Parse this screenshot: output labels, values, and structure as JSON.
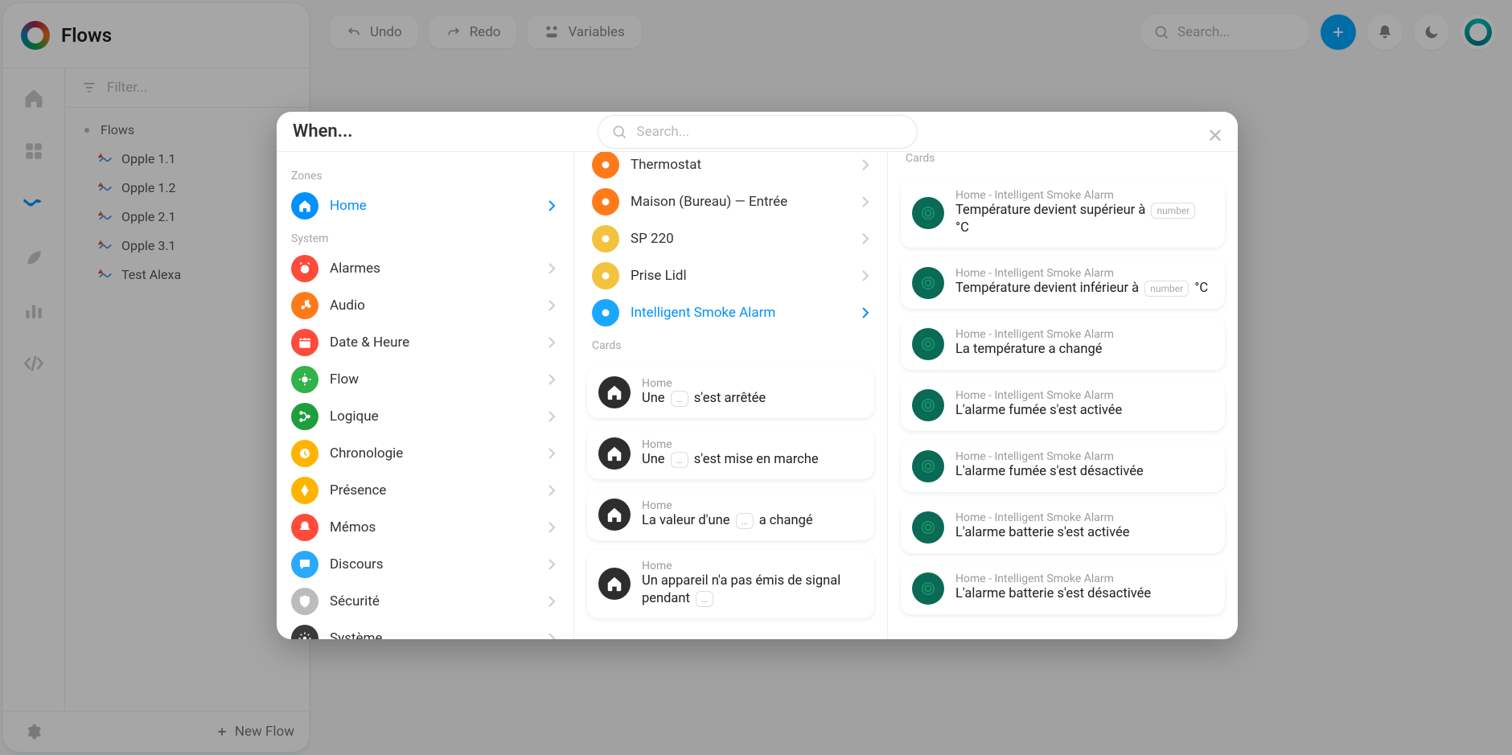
{
  "appTitle": "Flows",
  "topbar": {
    "undo": "Undo",
    "redo": "Redo",
    "variables": "Variables",
    "searchPlaceholder": "Search..."
  },
  "leftPanel": {
    "filterPlaceholder": "Filter...",
    "root": "Flows",
    "items": [
      "Opple 1.1",
      "Opple 1.2",
      "Opple 2.1",
      "Opple 3.1",
      "Test Alexa"
    ],
    "newFlow": "New Flow"
  },
  "modal": {
    "title": "When...",
    "searchPlaceholder": "Search...",
    "zonesLabel": "Zones",
    "systemLabel": "System",
    "zones": [
      {
        "label": "Home",
        "color": "#0290ff",
        "active": true
      }
    ],
    "system": [
      {
        "label": "Alarmes",
        "color": "#ff4b3a"
      },
      {
        "label": "Audio",
        "color": "#ff7a1a"
      },
      {
        "label": "Date & Heure",
        "color": "#ff4b3a"
      },
      {
        "label": "Flow",
        "color": "#32b24a"
      },
      {
        "label": "Logique",
        "color": "#1f9e3e"
      },
      {
        "label": "Chronologie",
        "color": "#ffb400"
      },
      {
        "label": "Présence",
        "color": "#ffb400"
      },
      {
        "label": "Mémos",
        "color": "#ff4b3a"
      },
      {
        "label": "Discours",
        "color": "#2aa9ff"
      },
      {
        "label": "Sécurité",
        "color": "#bcbcbc"
      },
      {
        "label": "Système",
        "color": "#3a3a3a"
      }
    ],
    "devices": [
      {
        "label": "Thermostat",
        "color": "#ff7a1a"
      },
      {
        "label": "Maison (Bureau) — Entrée",
        "color": "#ff7a1a"
      },
      {
        "label": "SP 220",
        "color": "#f3c23e"
      },
      {
        "label": "Prise Lidl",
        "color": "#f3c23e"
      },
      {
        "label": "Intelligent Smoke Alarm",
        "color": "#1aa7ff",
        "active": true
      }
    ],
    "cardsLabel": "Cards",
    "homeCards": [
      {
        "sub": "Home",
        "parts": [
          "Une ",
          "{pill}",
          " s'est arrêtée"
        ]
      },
      {
        "sub": "Home",
        "parts": [
          "Une ",
          "{pill}",
          " s'est mise en marche"
        ]
      },
      {
        "sub": "Home",
        "parts": [
          "La valeur d'une ",
          "{pill}",
          " a changé"
        ]
      },
      {
        "sub": "Home",
        "parts": [
          "Un appareil n'a pas émis de signal pendant ",
          "{pill}"
        ]
      }
    ],
    "deviceCardsLabel": "Cards",
    "deviceCards": [
      {
        "sub": "Home - Intelligent Smoke Alarm",
        "parts": [
          "Température devient supérieur à ",
          "{pill:number}",
          " °C"
        ]
      },
      {
        "sub": "Home - Intelligent Smoke Alarm",
        "parts": [
          "Température devient inférieur à ",
          "{pill:number}",
          " °C"
        ]
      },
      {
        "sub": "Home - Intelligent Smoke Alarm",
        "parts": [
          "La température a changé"
        ]
      },
      {
        "sub": "Home - Intelligent Smoke Alarm",
        "parts": [
          "L'alarme fumée s'est activée"
        ]
      },
      {
        "sub": "Home - Intelligent Smoke Alarm",
        "parts": [
          "L'alarme fumée s'est désactivée"
        ]
      },
      {
        "sub": "Home - Intelligent Smoke Alarm",
        "parts": [
          "L'alarme batterie s'est activée"
        ]
      },
      {
        "sub": "Home - Intelligent Smoke Alarm",
        "parts": [
          "L'alarme batterie s'est désactivée"
        ]
      }
    ]
  }
}
